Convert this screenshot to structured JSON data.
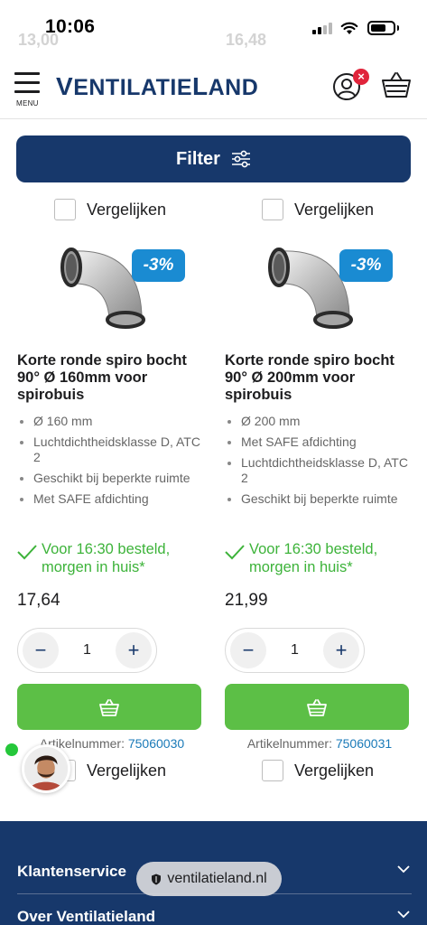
{
  "status_bar": {
    "time": "10:06",
    "ghost_prices": [
      "13,00",
      "16,48"
    ]
  },
  "header": {
    "menu_label": "MENU",
    "logo_parts": [
      "V",
      "ENTILATIE",
      "L",
      "AND"
    ],
    "account_badge": "×"
  },
  "filter": {
    "label": "Filter"
  },
  "compare_label": "Vergelijken",
  "products": [
    {
      "discount": "-3%",
      "title": "Korte ronde spiro bocht 90° Ø 160mm voor spirobuis",
      "specs": [
        "Ø 160 mm",
        "Luchtdichtheidsklasse D, ATC 2",
        "Geschikt bij beperkte ruimte",
        "Met SAFE afdichting"
      ],
      "delivery": "Voor 16:30 besteld, morgen in huis*",
      "price": "17,64",
      "quantity": "1",
      "article_label": "Artikelnummer:",
      "article_number": "75060030"
    },
    {
      "discount": "-3%",
      "title": "Korte ronde spiro bocht 90° Ø 200mm voor spirobuis",
      "specs": [
        "Ø 200 mm",
        "Met SAFE afdichting",
        "Luchtdichtheidsklasse D, ATC 2",
        "Geschikt bij beperkte ruimte"
      ],
      "delivery": "Voor 16:30 besteld, morgen in huis*",
      "price": "21,99",
      "quantity": "1",
      "article_label": "Artikelnummer:",
      "article_number": "75060031"
    }
  ],
  "footer": {
    "items": [
      "Klantenservice",
      "Over Ventilatieland"
    ]
  },
  "browser": {
    "url": "ventilatieland.nl"
  },
  "colors": {
    "brand_navy": "#17386b",
    "discount_blue": "#1a8bd2",
    "cta_green": "#5cbf46",
    "delivery_green": "#3db33a",
    "badge_red": "#e0243b"
  }
}
